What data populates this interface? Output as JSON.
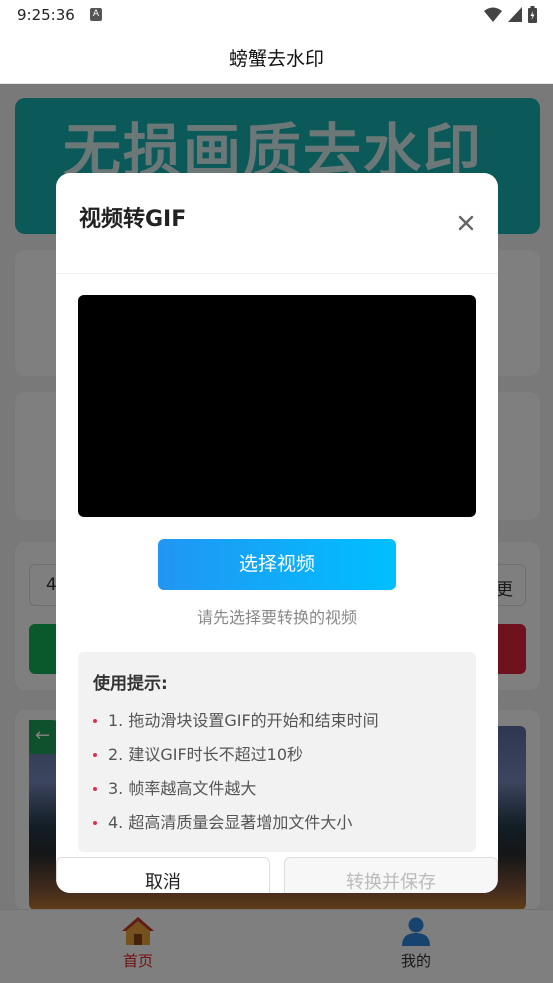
{
  "status_bar": {
    "time": "9:25:36",
    "notif_badge": "A"
  },
  "app": {
    "title": "螃蟹去水印"
  },
  "background": {
    "banner_text": "无损画质去水印",
    "input_left": "4",
    "input_right": "更",
    "back_arrow": "←"
  },
  "bottom_nav": [
    {
      "label": "首页",
      "icon": "home-icon",
      "active": true
    },
    {
      "label": "我的",
      "icon": "user-icon",
      "active": false
    }
  ],
  "dialog": {
    "title": "视频转GIF",
    "select_button": "选择视频",
    "hint": "请先选择要转换的视频",
    "tips_title": "使用提示:",
    "tips": [
      "1. 拖动滑块设置GIF的开始和结束时间",
      "2. 建议GIF时长不超过10秒",
      "3. 帧率越高文件越大",
      "4. 超高清质量会显著增加文件大小"
    ],
    "cancel_button": "取消",
    "convert_button": "转换并保存"
  },
  "colors": {
    "accent_blue": "#2196f3",
    "active_nav": "#e02020",
    "banner": "#19b3b3",
    "tip_bullet": "#e03050"
  }
}
